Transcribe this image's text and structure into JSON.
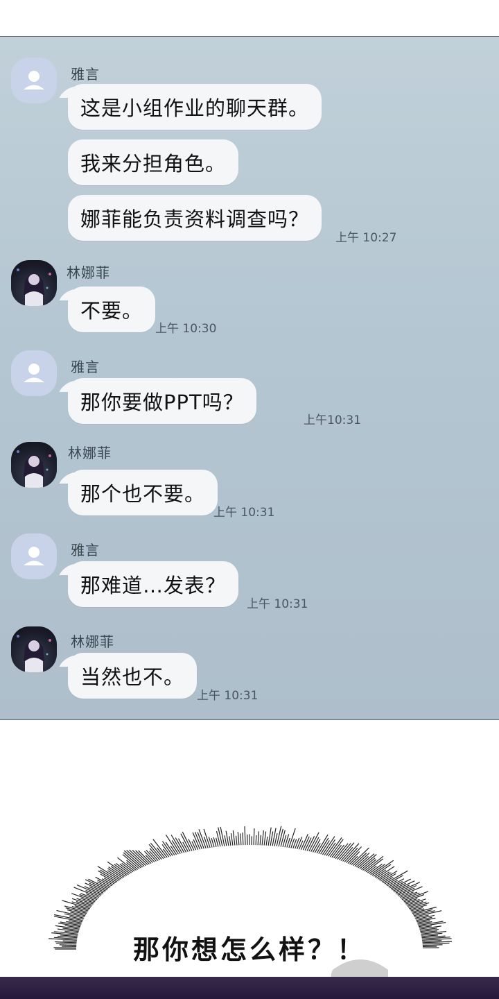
{
  "chat": {
    "messages": [
      {
        "sender": "雅言",
        "lines": [
          "这是小组作业的聊天群。",
          "我来分担角色。",
          "娜菲能负责资料调查吗？"
        ],
        "time": "上午 10:27"
      },
      {
        "sender": "林娜菲",
        "lines": [
          "不要。"
        ],
        "time": "上午 10:30"
      },
      {
        "sender": "雅言",
        "lines": [
          "那你要做PPT吗？"
        ],
        "time": "上午10:31"
      },
      {
        "sender": "林娜菲",
        "lines": [
          "那个也不要。"
        ],
        "time": "上午 10:31"
      },
      {
        "sender": "雅言",
        "lines": [
          "那难道…发表？"
        ],
        "time": "上午 10:31"
      },
      {
        "sender": "林娜菲",
        "lines": [
          "当然也不。"
        ],
        "time": "上午 10:31"
      }
    ]
  },
  "caption": {
    "text": "那你想怎么样？！"
  },
  "icons": {
    "default_avatar": "person-icon",
    "photo_avatar": "profile-photo"
  },
  "colors": {
    "chat_background": "#b8c8d3",
    "bubble": "#f4f6f8",
    "default_avatar": "#c8d3ea"
  }
}
